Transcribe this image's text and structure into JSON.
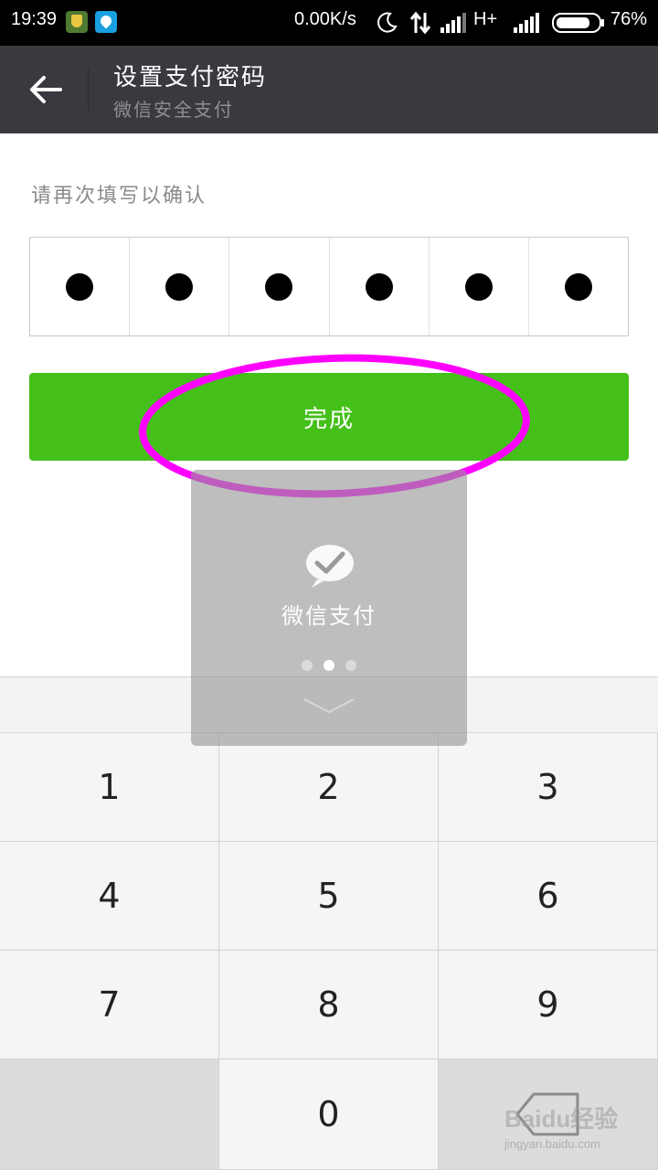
{
  "status_bar": {
    "time": "19:39",
    "net_speed": "0.00K/s",
    "network_type": "H+",
    "battery": "76%",
    "icons": [
      "shield-app-icon",
      "water-drop-app-icon",
      "moon-icon",
      "data-arrows-icon",
      "signal-icon",
      "signal-icon",
      "battery-icon"
    ]
  },
  "header": {
    "title": "设置支付密码",
    "subtitle": "微信安全支付"
  },
  "form": {
    "hint": "请再次填写以确认",
    "pin_filled": 6,
    "pin_length": 6
  },
  "done_button": {
    "label": "完成",
    "color": "#45c01a"
  },
  "annotation": {
    "ellipse_color": "#ff00ff"
  },
  "toast": {
    "label": "微信支付",
    "page_dots": 3,
    "active_dot": 1
  },
  "keypad": {
    "keys": [
      "1",
      "2",
      "3",
      "4",
      "5",
      "6",
      "7",
      "8",
      "9",
      "",
      "0",
      ""
    ]
  },
  "watermark": {
    "brand": "Baidu经验",
    "url": "jingyan.baidu.com"
  }
}
